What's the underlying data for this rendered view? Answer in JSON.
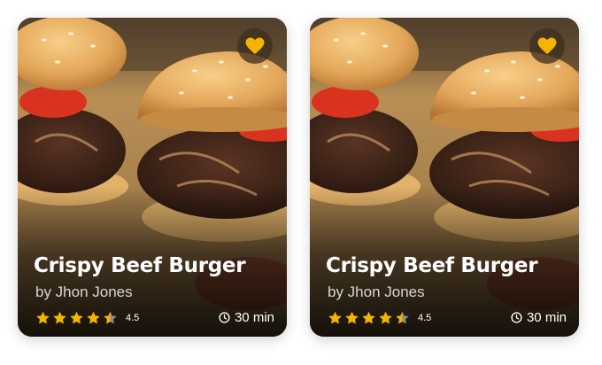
{
  "colors": {
    "star": "#f5b400",
    "heart": "#f5b400",
    "title_text": "#ffffff",
    "author_text": "#d6d6d6"
  },
  "icons": {
    "favorite": "heart-icon",
    "rating": "star-icon",
    "duration": "clock-icon"
  },
  "cards": [
    {
      "title": "Crispy Beef Burger",
      "author": "by Jhon Jones",
      "rating_label": "4.5",
      "rating": 4.5,
      "rating_max": 5,
      "duration": "30 min",
      "favorited": true
    },
    {
      "title": "Crispy Beef Burger",
      "author": "by Jhon Jones",
      "rating_label": "4.5",
      "rating": 4.5,
      "rating_max": 5,
      "duration": "30 min",
      "favorited": true
    }
  ]
}
